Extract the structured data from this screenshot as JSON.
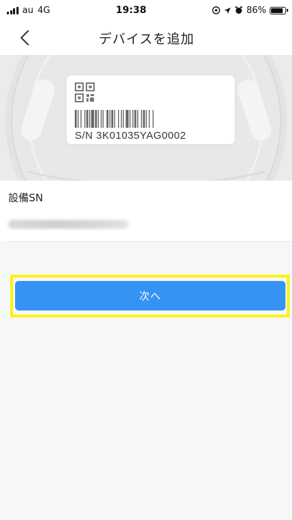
{
  "status_bar": {
    "carrier": "au",
    "network": "4G",
    "time": "19:38",
    "battery_percent": "86%",
    "battery_level": 0.86,
    "icons": [
      "signal-icon",
      "location-lock-icon",
      "location-arrow-icon",
      "alarm-icon",
      "battery-icon"
    ]
  },
  "nav": {
    "back_icon": "chevron-left-icon",
    "title": "デバイスを追加"
  },
  "device_image": {
    "sn_label": "S/N  3K01035YAG0002"
  },
  "sn_field": {
    "label": "設備SN",
    "value": ""
  },
  "next_button": {
    "label": "次へ"
  },
  "colors": {
    "accent": "#3593f3",
    "highlight": "#fff200",
    "background": "#f6f7f8"
  }
}
